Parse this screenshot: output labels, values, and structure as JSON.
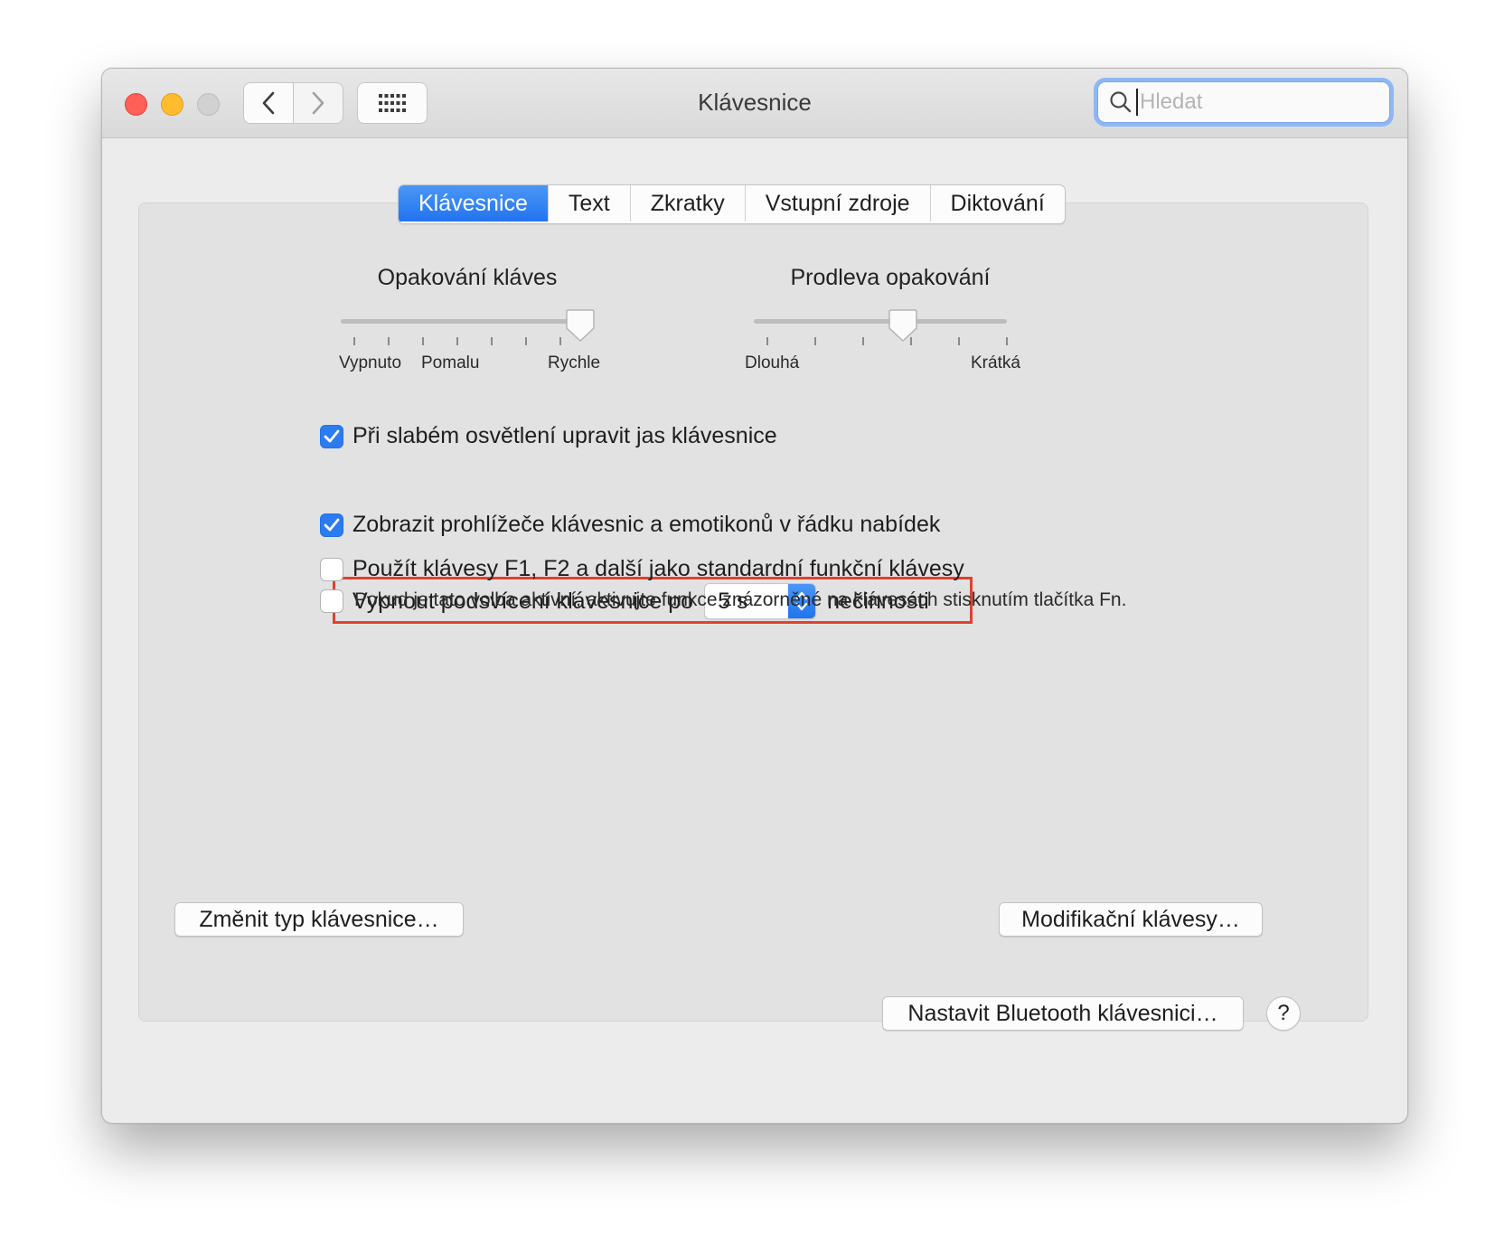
{
  "window": {
    "title": "Klávesnice"
  },
  "search": {
    "placeholder": "Hledat"
  },
  "tabs": [
    {
      "label": "Klávesnice",
      "active": true
    },
    {
      "label": "Text",
      "active": false
    },
    {
      "label": "Zkratky",
      "active": false
    },
    {
      "label": "Vstupní zdroje",
      "active": false
    },
    {
      "label": "Diktování",
      "active": false
    }
  ],
  "sliders": {
    "key_repeat": {
      "label": "Opakování kláves",
      "tick_labels": [
        "Vypnuto",
        "Pomalu",
        "Rychle"
      ],
      "position": 0.95
    },
    "repeat_delay": {
      "label": "Prodleva opakování",
      "tick_labels": [
        "Dlouhá",
        "Krátká"
      ],
      "position": 0.6
    }
  },
  "options": {
    "adjust_brightness": {
      "label": "Při slabém osvětlení upravit jas klávesnice",
      "checked": true
    },
    "backlight_off": {
      "label": "Vypnout podsvícení klávesnice po",
      "checked": false,
      "stepper_value": "5 s",
      "suffix": "nečinnosti"
    },
    "show_viewers": {
      "label": "Zobrazit prohlížeče klávesnic a emotikonů v řádku nabídek",
      "checked": true
    },
    "fn_keys": {
      "label": "Použít klávesy F1, F2 a další jako standardní funkční klávesy",
      "checked": false,
      "hint": "Pokud je tato volba aktivní, aktivujte funkce znázorněné na klávesách stisknutím tlačítka Fn."
    }
  },
  "buttons": {
    "change_type": "Změnit typ klávesnice…",
    "modifier_keys": "Modifikační klávesy…",
    "bluetooth": "Nastavit Bluetooth klávesnici…",
    "help": "?"
  },
  "colors": {
    "accent": "#2c7bf2",
    "highlight_box": "#e3402e",
    "close": "#fe5f57",
    "minimize": "#febc2e"
  }
}
